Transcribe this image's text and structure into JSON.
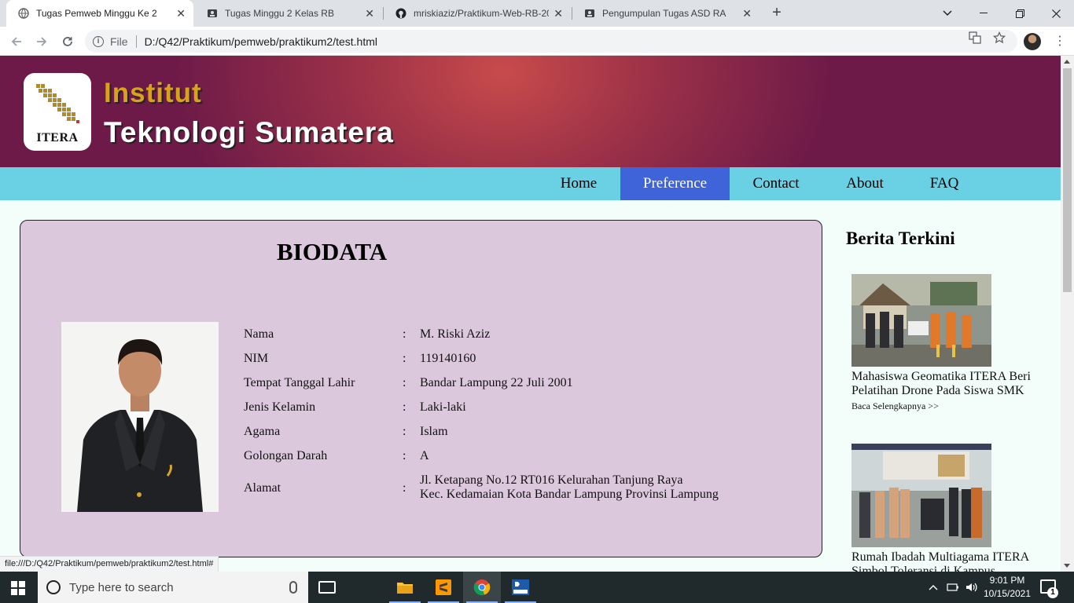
{
  "browser": {
    "tabs": [
      {
        "title": "Tugas Pemweb Minggu Ke 2",
        "active": true
      },
      {
        "title": "Tugas Minggu 2 Kelas RB",
        "active": false
      },
      {
        "title": "mriskiaziz/Praktikum-Web-RB-20",
        "active": false
      },
      {
        "title": "Pengumpulan Tugas ASD RA",
        "active": false
      }
    ],
    "new_tab": "+",
    "omnibox": {
      "scheme_label": "File",
      "url": "D:/Q42/Praktikum/pemweb/praktikum2/test.html"
    },
    "status_url": "file:///D:/Q42/Praktikum/pemweb/praktikum2/test.html#"
  },
  "site": {
    "logo_text": "ITERA",
    "title_line1": "Institut",
    "title_line2": "Teknologi Sumatera",
    "nav": [
      {
        "label": "Home",
        "active": false
      },
      {
        "label": "Preference",
        "active": true
      },
      {
        "label": "Contact",
        "active": false
      },
      {
        "label": "About",
        "active": false
      },
      {
        "label": "FAQ",
        "active": false
      }
    ]
  },
  "biodata": {
    "heading": "BIODATA",
    "separator": ":",
    "rows": [
      {
        "label": "Nama",
        "value": "M. Riski Aziz"
      },
      {
        "label": "NIM",
        "value": "119140160"
      },
      {
        "label": "Tempat Tanggal Lahir",
        "value": "Bandar Lampung 22 Juli 2001"
      },
      {
        "label": "Jenis Kelamin",
        "value": "Laki-laki"
      },
      {
        "label": "Agama",
        "value": "Islam"
      },
      {
        "label": "Golongan Darah",
        "value": "A"
      }
    ],
    "address": {
      "label": "Alamat",
      "line1": "Jl. Ketapang No.12 RT016 Kelurahan Tanjung Raya",
      "line2": "Kec. Kedamaian Kota Bandar Lampung Provinsi Lampung"
    }
  },
  "sidebar": {
    "title": "Berita Terkini",
    "news": [
      {
        "headline": "Mahasiswa Geomatika ITERA Beri Pelatihan Drone Pada Siswa SMK",
        "more": "Baca Selengkapnya >>"
      },
      {
        "headline": "Rumah Ibadah Multiagama ITERA Simbol Toleransi di Kampus",
        "more": ""
      }
    ]
  },
  "taskbar": {
    "search_placeholder": "Type here to search",
    "time": "9:01 PM",
    "date": "10/15/2021",
    "notification_count": "1"
  },
  "colors": {
    "header_dark": "#6d1a48",
    "header_light": "#c84b4b",
    "nav_bg": "#6ad0e4",
    "nav_active": "#3f63d9",
    "card_bg": "#dcc8dd",
    "page_bg": "#f3fdf9",
    "title_gold": "#d9a21a"
  }
}
